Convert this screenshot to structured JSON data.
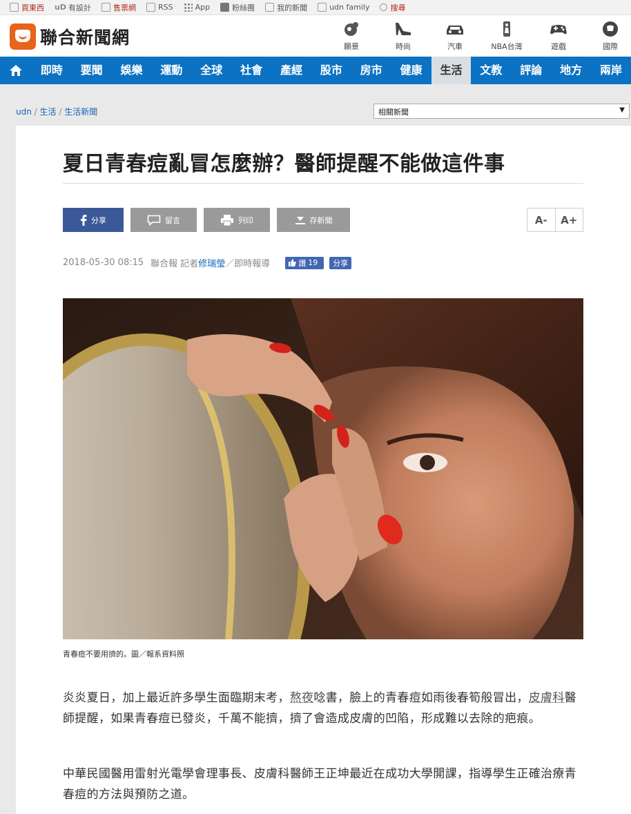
{
  "topbar": {
    "links": [
      "買東西",
      "有設計",
      "售票網",
      "RSS",
      "App",
      "粉絲團",
      "我的新聞",
      "udn family",
      "搜尋"
    ]
  },
  "header": {
    "logo_text": "聯合新聞網",
    "channels": [
      "願景",
      "時尚",
      "汽車",
      "NBA台灣",
      "遊戲",
      "國際"
    ]
  },
  "nav": {
    "items": [
      "即時",
      "要聞",
      "娛樂",
      "運動",
      "全球",
      "社會",
      "產經",
      "股市",
      "房市",
      "健康",
      "生活",
      "文教",
      "評論",
      "地方",
      "兩岸"
    ],
    "active": "生活"
  },
  "breadcrumb": {
    "home": "udn",
    "sep": "/",
    "level1": "生活",
    "level2": "生活新聞"
  },
  "related_select": {
    "value": "相關新聞",
    "arrow": "▼"
  },
  "article": {
    "title": "夏日青春痘亂冒怎麼辦？醫師提醒不能做這件事",
    "buttons": {
      "share": "分享",
      "comment": "留言",
      "print": "列印",
      "save": "存新聞"
    },
    "font_smaller": "A-",
    "font_larger": "A+",
    "date": "2018-05-30 08:15",
    "source": "聯合報",
    "reporter_prefix": "記者",
    "reporter": "修瑞瑩",
    "reporter_suffix": "／即時報導",
    "like_label": "讚",
    "like_count": "19",
    "fb_share": "分享",
    "photo_caption": "青春痘不要用擠的。圖／報系資料照",
    "para1_a": "炎炎夏日，加上最近許多學生面臨期末考，",
    "para1_link1": "熬夜",
    "para1_b": "唸書，臉上的青春痘如雨後春筍般冒出，",
    "para1_link2": "皮膚科",
    "para1_c": "醫師提醒，如果青春痘已發炎，千萬不能擠，擠了會造成皮膚的凹陷，形成難以去除的疤痕。",
    "para2": "中華民國醫用雷射光電學會理事長、皮膚科醫師王正坤最近在成功大學開課，指導學生正確治療青春痘的方法與預防之道。"
  },
  "colors": {
    "nav_blue": "#0b72c4",
    "logo_orange": "#e8641b",
    "facebook": "#3b5998",
    "link_blue": "#1565b8"
  }
}
